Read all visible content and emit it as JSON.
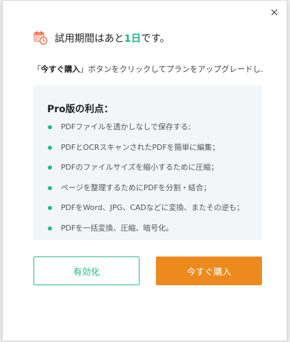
{
  "dialog": {
    "title_prefix": "試用期間はあと",
    "title_days": "1日",
    "title_suffix": "です。",
    "desc_prefix": "「",
    "desc_button_name": "今すぐ購入",
    "desc_suffix": "」ボタンをクリックしてプランをアップグレードし.",
    "benefits_title": "Pro版の利点：",
    "benefits": [
      "PDFファイルを透かしなしで保存する;",
      "PDFとOCRスキャンされたPDFを簡単に編集；",
      "PDFのファイルサイズを縮小するために圧縮；",
      "ページを整理するためにPDFを分割・結合；",
      "PDFをWord、JPG、CADなどに変換、またその逆も；",
      "PDFを一括変換、圧縮、暗号化。"
    ],
    "activate_label": "有効化",
    "buy_label": "今すぐ購入",
    "close_icon": "close-icon",
    "calendar_icon": "calendar-clock-icon"
  },
  "colors": {
    "accent_green": "#21b586",
    "buy_orange": "#ec8a1e",
    "benefit_bg": "#f2f6f8"
  }
}
